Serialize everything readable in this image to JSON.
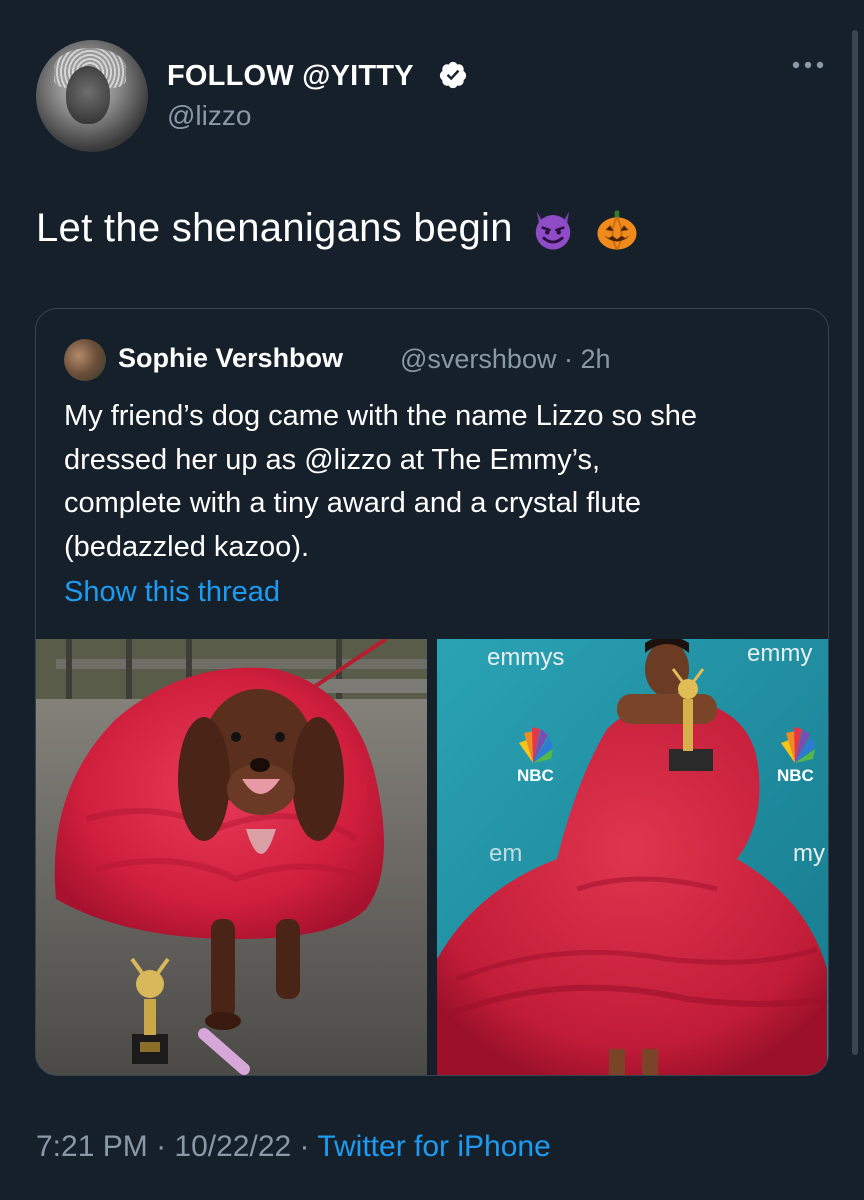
{
  "tweet": {
    "author": {
      "display_name": "FOLLOW @YITTY",
      "handle": "@lizzo",
      "verified": true
    },
    "text": "Let the shenanigans begin",
    "emojis": [
      "smiling-imp-icon",
      "jack-o-lantern-icon"
    ],
    "timestamp_time": "7:21 PM",
    "timestamp_date": "10/22/22",
    "separator": "·",
    "source": "Twitter for iPhone"
  },
  "quoted_tweet": {
    "author_name": "Sophie Vershbow",
    "author_handle": "@svershbow",
    "time_ago": "2h",
    "separator": "·",
    "text_lines": [
      "My friend’s dog came with the name Lizzo so she",
      "dressed her up as @lizzo at The Emmy’s,",
      "complete with a tiny award and a crystal flute",
      "(bedazzled kazoo)."
    ],
    "show_thread_label": "Show this thread",
    "backdrop_text": {
      "emmys_left": "emmys",
      "emmys_right": "emmy",
      "nbc": "NBC",
      "partial_em": "em",
      "partial_my": "my"
    }
  },
  "colors": {
    "background": "#15202b",
    "text_primary": "#ffffff",
    "text_secondary": "#8b98a5",
    "link": "#1d9bf0",
    "border": "#38444d",
    "dress_red": "#d42a48",
    "emmys_teal": "#1f8fa2"
  }
}
